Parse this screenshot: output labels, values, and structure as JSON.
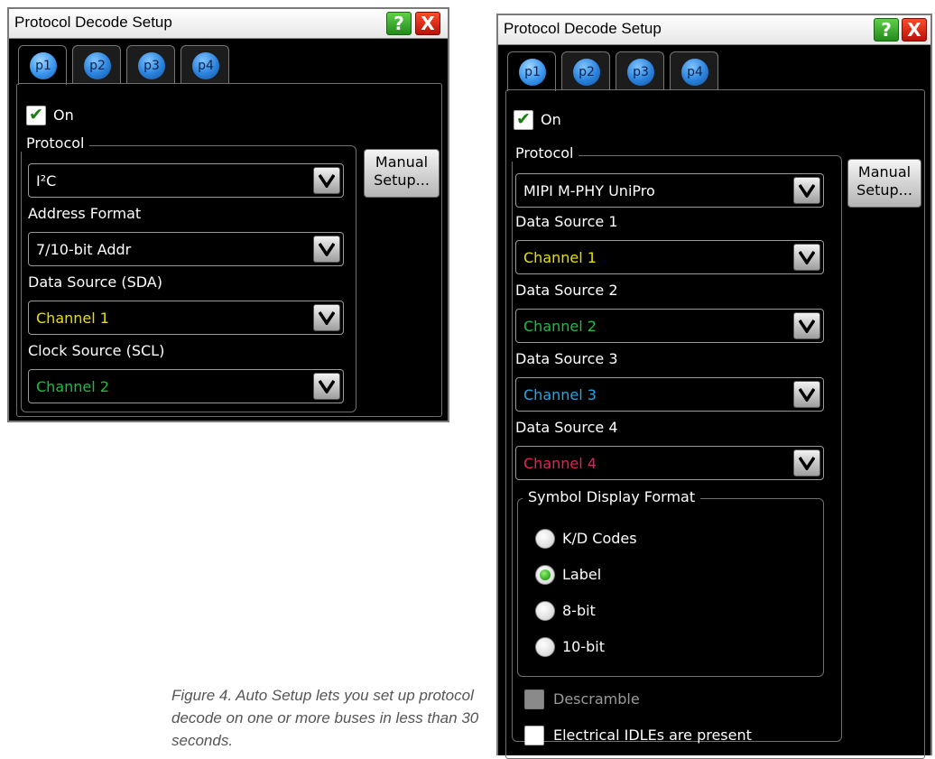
{
  "colors": {
    "channel1": "#e8e000",
    "channel2": "#19c040",
    "channel3": "#23a8e8",
    "channel4": "#e8205a"
  },
  "dialog1": {
    "title": "Protocol Decode Setup",
    "help_label": "?",
    "close_label": "X",
    "tabs": [
      "p1",
      "p2",
      "p3",
      "p4"
    ],
    "on_label": "On",
    "protocol_label": "Protocol",
    "protocol_value": "I²C",
    "address_format_label": "Address Format",
    "address_format_value": "7/10-bit Addr",
    "data_source_label": "Data Source (SDA)",
    "data_source_value": "Channel 1",
    "clock_source_label": "Clock Source (SCL)",
    "clock_source_value": "Channel 2",
    "manual_setup_line1": "Manual",
    "manual_setup_line2": "Setup..."
  },
  "dialog2": {
    "title": "Protocol Decode Setup",
    "help_label": "?",
    "close_label": "X",
    "tabs": [
      "p1",
      "p2",
      "p3",
      "p4"
    ],
    "on_label": "On",
    "protocol_label": "Protocol",
    "protocol_value": "MIPI M-PHY UniPro",
    "sources": [
      {
        "label": "Data Source 1",
        "value": "Channel 1"
      },
      {
        "label": "Data Source 2",
        "value": "Channel 2"
      },
      {
        "label": "Data Source 3",
        "value": "Channel 3"
      },
      {
        "label": "Data Source 4",
        "value": "Channel 4"
      }
    ],
    "manual_setup_line1": "Manual",
    "manual_setup_line2": "Setup...",
    "symbol_format_label": "Symbol Display Format",
    "symbol_options": [
      "K/D Codes",
      "Label",
      "8-bit",
      "10-bit"
    ],
    "symbol_selected": "Label",
    "descramble_label": "Descramble",
    "idles_label": "Electrical IDLEs are present"
  },
  "caption": "Figure 4. Auto Setup lets you set up protocol decode on one or more buses in less than 30 seconds."
}
